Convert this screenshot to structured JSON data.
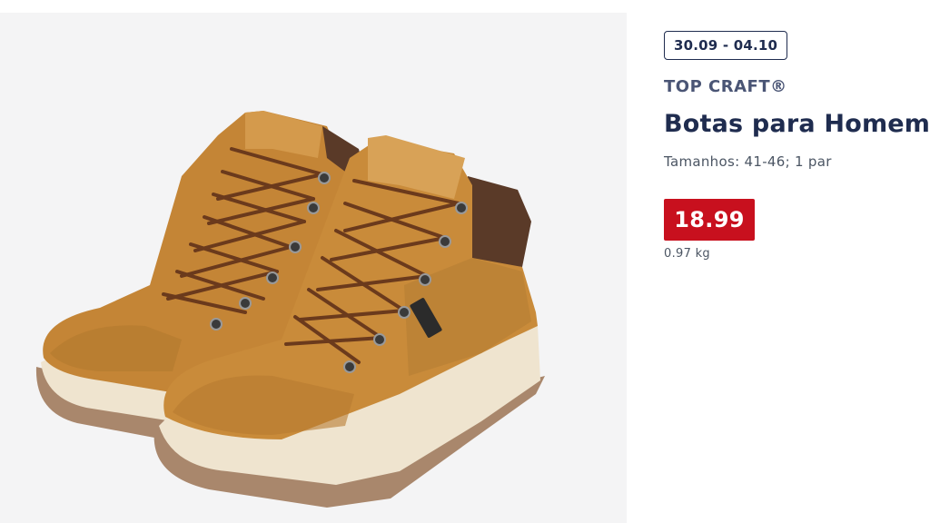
{
  "product": {
    "image_alt": "boots-photo",
    "date_range": "30.09 - 04.10",
    "brand": "TOP CRAFT®",
    "title": "Botas para Homem",
    "subtitle": "Tamanhos: 41-46; 1 par",
    "price": "18.99",
    "unit": "0.97 kg"
  },
  "colors": {
    "price_bg": "#c8101e",
    "title": "#1f2c4f",
    "suede": "#c98b3a",
    "collar": "#5a3a28",
    "sole": "#efe4cf",
    "outsole": "#a9876c"
  }
}
